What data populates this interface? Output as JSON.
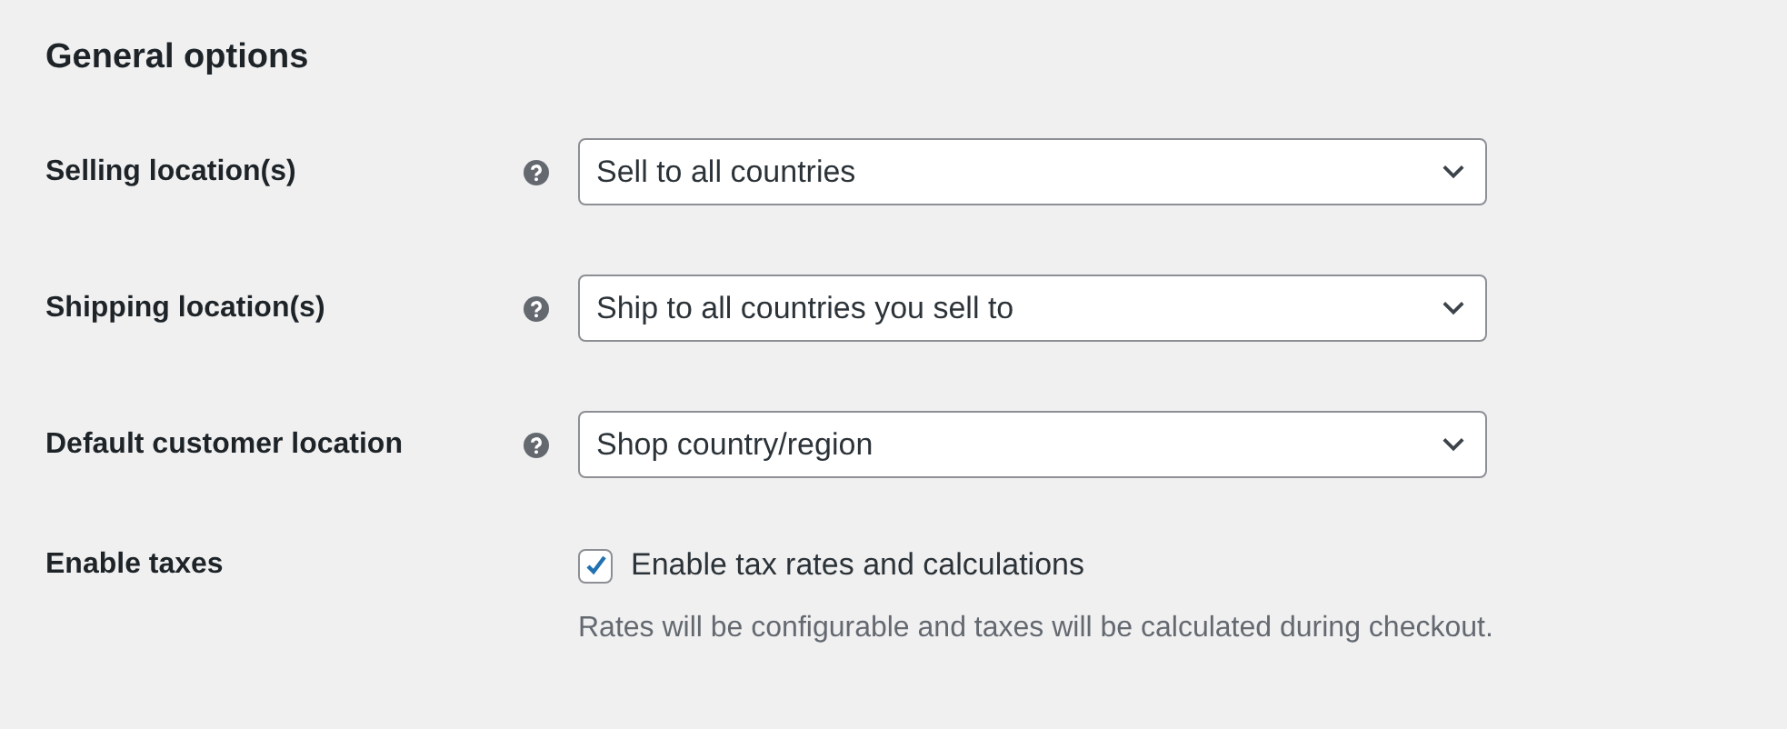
{
  "section": {
    "title": "General options"
  },
  "fields": [
    {
      "kind": "select",
      "label": "Selling location(s)",
      "help": true,
      "value": "Sell to all countries"
    },
    {
      "kind": "select",
      "label": "Shipping location(s)",
      "help": true,
      "value": "Ship to all countries you sell to"
    },
    {
      "kind": "select",
      "label": "Default customer location",
      "help": true,
      "value": "Shop country/region"
    },
    {
      "kind": "checkbox",
      "label": "Enable taxes",
      "help": false,
      "checked": true,
      "option": "Enable tax rates and calculations",
      "description": "Rates will be configurable and taxes will be calculated during checkout."
    }
  ]
}
